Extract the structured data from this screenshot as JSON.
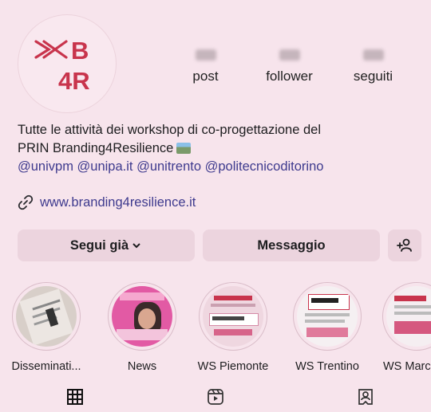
{
  "profile": {
    "logo_line1": "⋙B",
    "logo_line2": "4R",
    "stats": [
      {
        "label": "post"
      },
      {
        "label": "follower"
      },
      {
        "label": "seguiti"
      }
    ]
  },
  "bio": {
    "line1": "Tutte le attività dei workshop di co-progettazione del",
    "line2": "PRIN Branding4Resilience",
    "mentions": "@univpm @unipa.it @unitrento @politecnicoditorino",
    "link": "www.branding4resilience.it"
  },
  "actions": {
    "follow_label": "Segui già",
    "message_label": "Messaggio"
  },
  "highlights": [
    {
      "label": "Disseminati..."
    },
    {
      "label": "News"
    },
    {
      "label": "WS Piemonte"
    },
    {
      "label": "WS Trentino"
    },
    {
      "label": "WS Marc"
    }
  ],
  "colors": {
    "background": "#f7e4ec",
    "brand": "#c8344c",
    "button": "#ecd4de",
    "link": "#3e3a8e"
  }
}
